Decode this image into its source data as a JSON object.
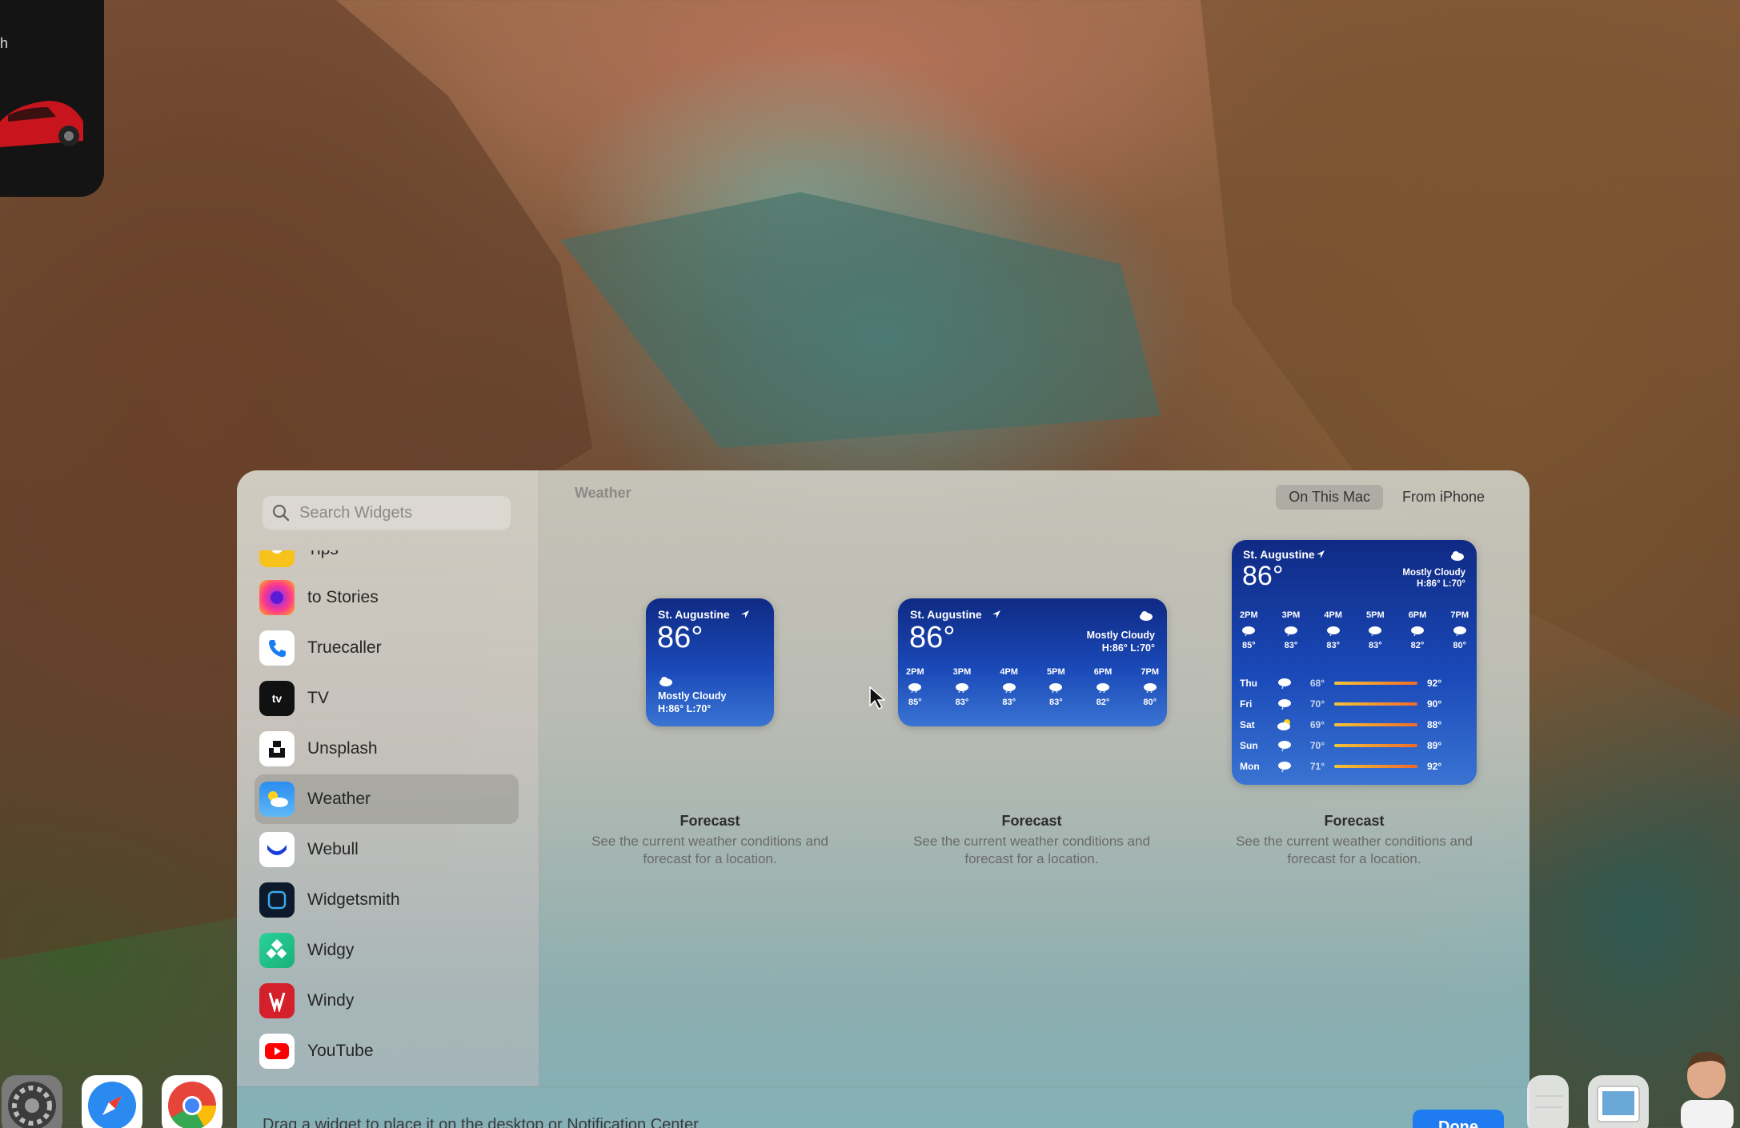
{
  "topcard": {
    "letter": "h"
  },
  "sidebar": {
    "search_placeholder": "Search Widgets",
    "items": [
      {
        "label": "Tips",
        "icon": "tips-icon"
      },
      {
        "label": "to Stories",
        "icon": "stories-icon"
      },
      {
        "label": "Truecaller",
        "icon": "phone-icon"
      },
      {
        "label": "TV",
        "icon": "apple-tv-icon"
      },
      {
        "label": "Unsplash",
        "icon": "unsplash-icon"
      },
      {
        "label": "Weather",
        "icon": "weather-icon",
        "selected": true
      },
      {
        "label": "Webull",
        "icon": "webull-icon"
      },
      {
        "label": "Widgetsmith",
        "icon": "widgetsmith-icon"
      },
      {
        "label": "Widgy",
        "icon": "widgy-icon"
      },
      {
        "label": "Windy",
        "icon": "windy-icon"
      },
      {
        "label": "YouTube",
        "icon": "youtube-icon"
      }
    ]
  },
  "main": {
    "title": "Weather",
    "tabs": [
      {
        "label": "On This Mac",
        "active": true
      },
      {
        "label": "From iPhone",
        "active": false
      }
    ]
  },
  "weather": {
    "city": "St. Augustine",
    "temp": "86°",
    "condition": "Mostly Cloudy",
    "hilo": "H:86° L:70°",
    "hours": [
      {
        "time": "2PM",
        "temp": "85°"
      },
      {
        "time": "3PM",
        "temp": "83°"
      },
      {
        "time": "4PM",
        "temp": "83°"
      },
      {
        "time": "5PM",
        "temp": "83°"
      },
      {
        "time": "6PM",
        "temp": "82°"
      },
      {
        "time": "7PM",
        "temp": "80°"
      }
    ],
    "days": [
      {
        "day": "Thu",
        "lo": "68°",
        "hi": "92°"
      },
      {
        "day": "Fri",
        "lo": "70°",
        "hi": "90°"
      },
      {
        "day": "Sat",
        "lo": "69°",
        "hi": "88°"
      },
      {
        "day": "Sun",
        "lo": "70°",
        "hi": "89°"
      },
      {
        "day": "Mon",
        "lo": "71°",
        "hi": "92°"
      }
    ]
  },
  "captions": {
    "title": "Forecast",
    "desc": "See the current weather conditions and forecast for a location."
  },
  "footer": {
    "hint": "Drag a widget to place it on the desktop or Notification Center",
    "done_label": "Done"
  },
  "colors": {
    "accent": "#1f7cf0",
    "widget_top": "#0f2a84",
    "widget_bottom": "#3a74d2"
  }
}
